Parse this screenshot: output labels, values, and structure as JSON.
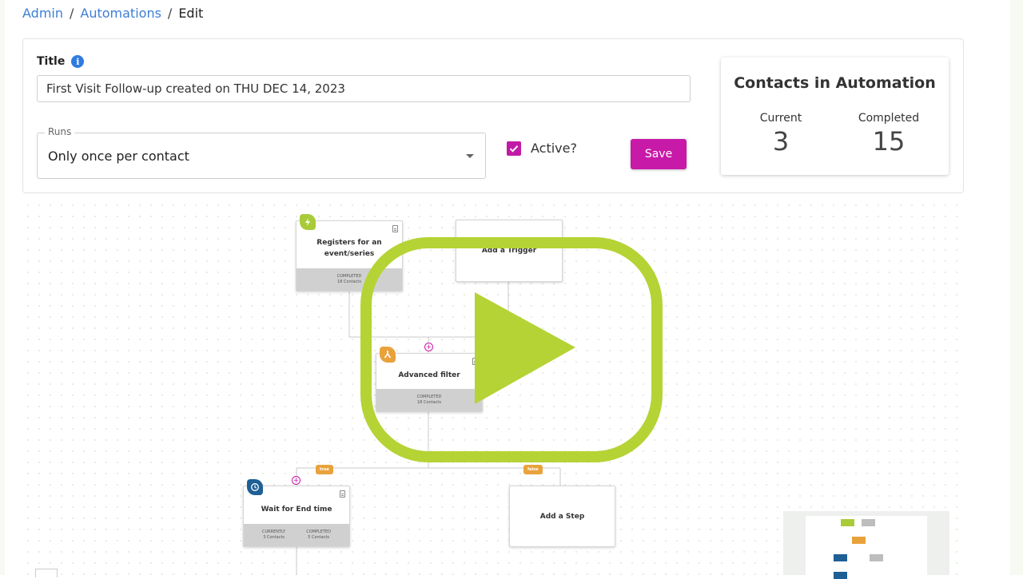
{
  "breadcrumb": {
    "admin": "Admin",
    "automations": "Automations",
    "current": "Edit",
    "separator": "/"
  },
  "settings": {
    "title_label": "Title",
    "title_value": "First Visit Follow-up created on THU DEC 14, 2023",
    "runs_label": "Runs",
    "runs_value": "Only once per contact",
    "active_label": "Active?",
    "active_checked": true,
    "save_label": "Save"
  },
  "contacts": {
    "title": "Contacts in Automation",
    "current_label": "Current",
    "current_value": "3",
    "completed_label": "Completed",
    "completed_value": "15"
  },
  "flow": {
    "trigger_node": {
      "title": "Registers for an event/series",
      "stat_label": "COMPLETED",
      "stat_value": "18 Contacts"
    },
    "add_trigger": {
      "title": "Add a Trigger"
    },
    "filter_node": {
      "title": "Advanced filter",
      "stat_label": "COMPLETED",
      "stat_value": "18 Contacts"
    },
    "true_tag": "true",
    "false_tag": "false",
    "wait_node": {
      "title": "Wait for End time",
      "current_label": "CURRENTLY",
      "current_value": "3 Contacts",
      "completed_label": "COMPLETED",
      "completed_value": "5 Contacts"
    },
    "add_step": {
      "title": "Add a Step"
    },
    "plus": "+"
  },
  "colors": {
    "link": "#3d7fd6",
    "accent": "#c71aa8",
    "trigger_badge": "#a9cb3a",
    "filter_badge": "#e9a23b",
    "wait_badge": "#1e5f96",
    "play_overlay": "#b5d335"
  },
  "icons": {
    "info": "info-icon",
    "dropdown": "chevron-down-icon",
    "check": "check-icon",
    "trigger": "lightning-icon",
    "filter": "filter-fork-icon",
    "wait": "clock-icon",
    "play": "play-icon"
  }
}
